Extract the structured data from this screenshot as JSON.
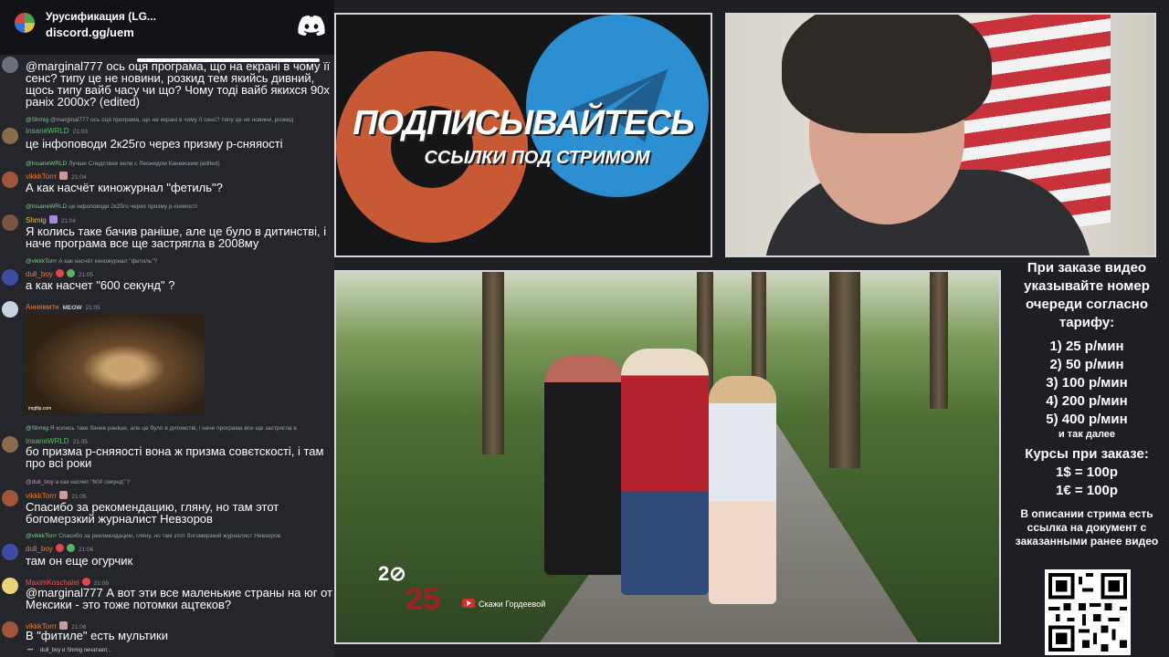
{
  "server": {
    "name": "Урусификация (LG...",
    "invite": "discord.gg/uem"
  },
  "messages": [
    {
      "text": "@marginal777 ось оця програма, що на екрані в чому її сенс? типу це не новини, розкид тем якийсь дивний, щось типу вайб часу чи що? Чому тоді вайб якихся 90х ранiх 2000х? (edited)"
    },
    {
      "reply_user": "@Shmig",
      "reply_text": "@marginal777 ось оця програма, що на екрані в чому її сенс? типу це не новини, розкид",
      "user": "InsaneWRLD",
      "time": "21:03",
      "text": "це інфоповоди 2к25го через призму р-сняяості"
    },
    {
      "reply_user": "@InsaneWRLD",
      "reply_text": "Лучше Следствие вели с Леонидом Каневским (edited)",
      "user": "vikkkTorrr",
      "time": "21:04",
      "text": "А как насчёт киножурнал \"фетиль\"?"
    },
    {
      "reply_user": "@InsaneWRLD",
      "reply_text": "це інфоповоди 2к25го через призму р-сняяості",
      "user": "Shmig",
      "time": "21:04",
      "text": "Я колись таке бачив раніше, але це було в дитинстві, і наче програма все ще застрягла в 2008му"
    },
    {
      "reply_user": "@vikkkTorrr",
      "reply_text": "А как насчёт киножурнал \"фетиль\"?",
      "user": "dull_boy",
      "time": "21:05",
      "text": "а как насчет \"600 секунд\" ?"
    },
    {
      "user": "Аннямитн",
      "time": "21:05",
      "tag": "MEOW",
      "gif_caption": "imgflip.com"
    },
    {
      "reply_user": "@Shmig",
      "reply_text": "Я колись таке бачив раніше, але це було в дитинстві, і наче програма все ще застрягла в",
      "user": "InsaneWRLD",
      "time": "21:05",
      "text": "бо призма р-сняяості вона ж призма совєтскості, і там про всі роки"
    },
    {
      "reply_user": "@dull_boy",
      "reply_text": "а как насчет \"600 секунд\" ?",
      "user": "vikkkTorrr",
      "time": "21:05",
      "text": "Спасибо за рекомендацию, гляну, но там этот богомерзкий журналист Невзоров"
    },
    {
      "reply_user": "@vikkkTorrr",
      "reply_text": "Спасибо за рекомендацию, гляну, но там этот богомерзкий журналист Невзоров",
      "user": "dull_boy",
      "time": "21:06",
      "text": "там он еще огурчик"
    },
    {
      "user": "MaximKoschatel",
      "time": "21:06",
      "text": "@marginal777 А вот эти все маленькие страны на юг от Мексики - это тоже потомки ацтеков?"
    },
    {
      "user": "vikkkTorrr",
      "time": "21:06",
      "text": "В \"фитиле\" есть мультики"
    }
  ],
  "typing": "dull_boy и Shmig печатают...",
  "promo": {
    "title": "ПОДПИСЫВАЙТЕСЬ",
    "subtitle": "ССЫЛКИ ПОД СТРИМОМ"
  },
  "video": {
    "year_top": "2⊘",
    "year_bottom": "25",
    "channel": "Скажи Гордеевой"
  },
  "pricing": {
    "title": "При заказе видео указывайте номер очереди согласно тарифу:",
    "tiers": [
      "1) 25 р/мин",
      "2) 50 р/мин",
      "3) 100 р/мин",
      "4) 200 р/мин",
      "5) 400 р/мин"
    ],
    "and_more": "и так далее",
    "rates_title": "Курсы при заказе:",
    "rates": [
      "1$ = 100р",
      "1€ = 100р"
    ],
    "description": "В описании стрима есть ссылка на документ с заказанными ранее видео"
  },
  "colors": {
    "chat_bg": "#25262b",
    "server_bar": "#121316",
    "name_green": "#56c06c",
    "name_yellow": "#e8c544",
    "name_orange": "#e57f3c",
    "name_red": "#e4565a",
    "telegram_blue": "#2c8fd1",
    "promo_orange": "#c75a35"
  },
  "icons": [
    "discord-icon",
    "telegram-icon",
    "youtube-icon",
    "qr-code"
  ]
}
